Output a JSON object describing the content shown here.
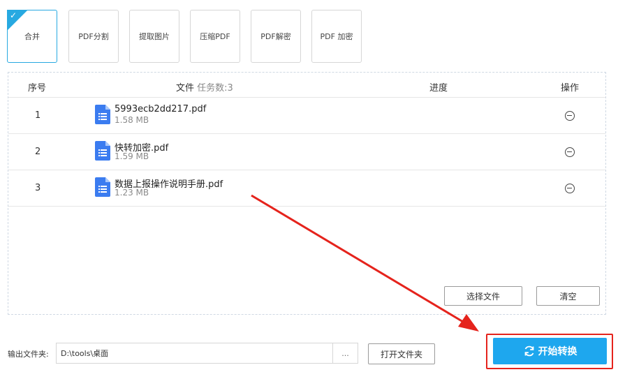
{
  "tabs": [
    {
      "label": "合并",
      "active": true
    },
    {
      "label": "PDF分割",
      "active": false
    },
    {
      "label": "提取图片",
      "active": false
    },
    {
      "label": "压缩PDF",
      "active": false
    },
    {
      "label": "PDF解密",
      "active": false
    },
    {
      "label": "PDF 加密",
      "active": false
    }
  ],
  "table": {
    "headers": {
      "index": "序号",
      "file": "文件",
      "task_count": "任务数:3",
      "progress": "进度",
      "action": "操作"
    },
    "rows": [
      {
        "index": "1",
        "name": "5993ecb2dd217.pdf",
        "size": "1.58 MB"
      },
      {
        "index": "2",
        "name": "快转加密.pdf",
        "size": "1.59 MB"
      },
      {
        "index": "3",
        "name": "数据上报操作说明手册.pdf",
        "size": "1.23 MB"
      }
    ],
    "select_files_label": "选择文件",
    "clear_label": "清空"
  },
  "output": {
    "label": "输出文件夹:",
    "path": "D:\\tools\\桌面",
    "browse_label": "...",
    "open_folder_label": "打开文件夹"
  },
  "start_button_label": "开始转换",
  "colors": {
    "accent": "#27a9e1",
    "start_button": "#1ea7ee",
    "annotation_red": "#e5231c",
    "file_icon": "#3b7cf0"
  }
}
